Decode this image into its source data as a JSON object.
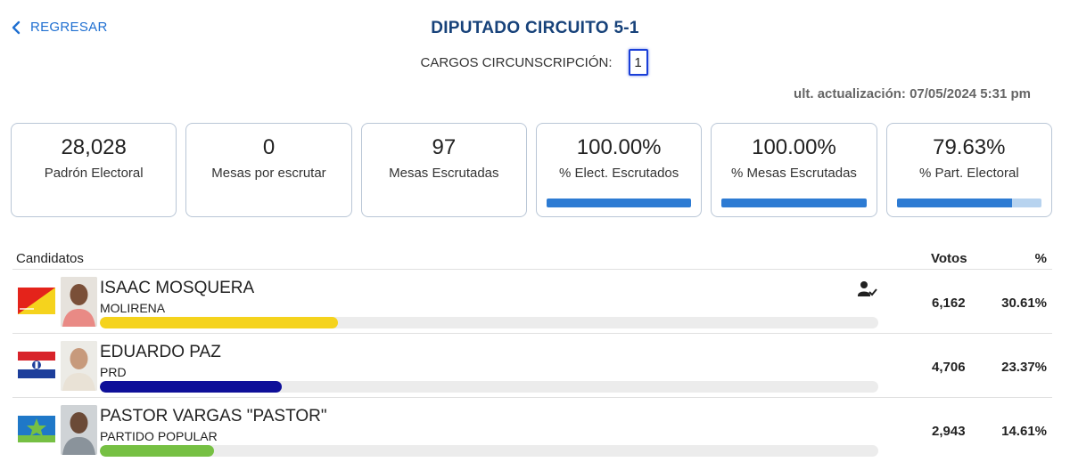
{
  "header": {
    "back_label": "REGRESAR",
    "title": "DIPUTADO CIRCUITO 5-1",
    "cargos_label": "CARGOS CIRCUNSCRIPCIÓN:",
    "cargos_value": "1",
    "updated": "ult. actualización: 07/05/2024 5:31 pm"
  },
  "stats": [
    {
      "value": "28,028",
      "label": "Padrón Electoral"
    },
    {
      "value": "0",
      "label": "Mesas por escrutar"
    },
    {
      "value": "97",
      "label": "Mesas Escrutadas"
    },
    {
      "value": "100.00%",
      "label": "% Elect. Escrutados",
      "progress": 1.0
    },
    {
      "value": "100.00%",
      "label": "% Mesas Escrutadas",
      "progress": 1.0
    },
    {
      "value": "79.63%",
      "label": "% Part. Electoral",
      "progress": 0.7963
    }
  ],
  "table": {
    "col_candidates": "Candidatos",
    "col_votes": "Votos",
    "col_pct": "%"
  },
  "candidates": [
    {
      "name": "ISAAC MOSQUERA",
      "party": "MOLIRENA",
      "votes": "6,162",
      "pct": "30.61%",
      "share": 0.3061,
      "bar_color": "#f5d31d",
      "elected": true,
      "flag_icon": "molirena-flag-icon"
    },
    {
      "name": "EDUARDO PAZ",
      "party": "PRD",
      "votes": "4,706",
      "pct": "23.37%",
      "share": 0.2337,
      "bar_color": "#0e0f99",
      "elected": false,
      "flag_icon": "prd-flag-icon"
    },
    {
      "name": "PASTOR VARGAS \"PASTOR\"",
      "party": "PARTIDO POPULAR",
      "votes": "2,943",
      "pct": "14.61%",
      "share": 0.1461,
      "bar_color": "#76c043",
      "elected": false,
      "flag_icon": "partido-popular-flag-icon"
    }
  ],
  "colors": {
    "accent": "#1f6fd1",
    "title": "#17427a",
    "progress": "#2d7bd3",
    "progress_track": "#b7d3ef"
  }
}
